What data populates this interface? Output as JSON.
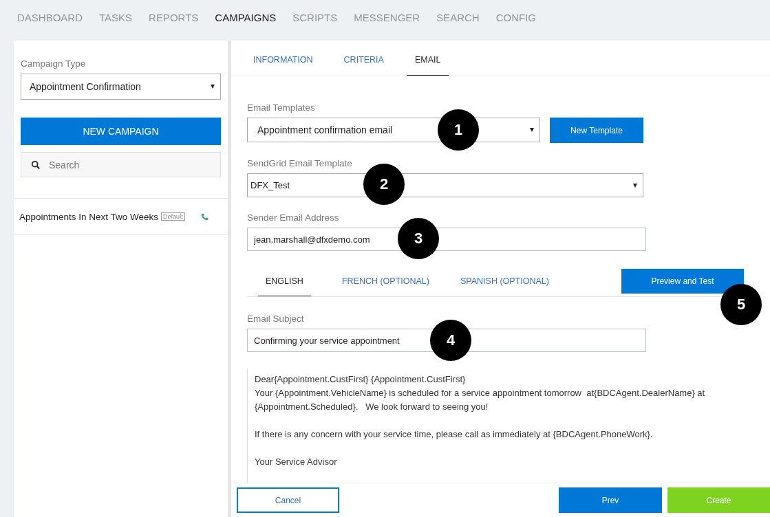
{
  "nav": [
    {
      "label": "DASHBOARD",
      "selected": false
    },
    {
      "label": "TASKS",
      "selected": false
    },
    {
      "label": "REPORTS",
      "selected": false
    },
    {
      "label": "CAMPAIGNS",
      "selected": true
    },
    {
      "label": "SCRIPTS",
      "selected": false
    },
    {
      "label": "MESSENGER",
      "selected": false
    },
    {
      "label": "SEARCH",
      "selected": false
    },
    {
      "label": "CONFIG",
      "selected": false
    }
  ],
  "sidebar": {
    "campaign_type_label": "Campaign Type",
    "campaign_type": "Appointment Confirmation",
    "new_button": "NEW CAMPAIGN",
    "search": {
      "placeholder": "Search"
    },
    "campaigns": [
      {
        "name": "Appointments In Next Two Weeks",
        "badge": "Default"
      }
    ]
  },
  "tabs": [
    {
      "label": "INFORMATION",
      "selected": false
    },
    {
      "label": "CRITERIA",
      "selected": false
    },
    {
      "label": "EMAIL",
      "selected": true
    }
  ],
  "email_templates": {
    "label": "Email Templates",
    "value": "Appointment confirmation email",
    "button": "New Template"
  },
  "sendgrid_template": {
    "label": "SendGrid Email Template",
    "value": "DFX_Test"
  },
  "sender": {
    "label": "Sender Email Address",
    "value": "jean.marshall@dfxdemo.com"
  },
  "language_tabs": [
    {
      "label": "ENGLISH",
      "selected": true
    },
    {
      "label": "FRENCH (OPTIONAL)",
      "selected": false
    },
    {
      "label": "SPANISH (OPTIONAL)",
      "selected": false
    }
  ],
  "preview_button": "Preview and Test",
  "subject": {
    "label": "Email Subject",
    "value": "Confirming your service appointment"
  },
  "body": [
    [
      "Dear{Appointment.CustFirst} {Appointment.CustFirst}",
      "Your {Appointment.VehicleName} is scheduled for a service appointment tomorrow  at{BDCAgent.DealerName} at {Appointment.Scheduled}.   We look forward to seeing you!"
    ],
    [
      "If there is any concern with your service time, please call as immediately at {BDCAgent.PhoneWork}."
    ],
    [
      "Your Service Advisor"
    ]
  ],
  "footer": {
    "cancel": "Cancel",
    "prev": "Prev",
    "create": "Create"
  },
  "callouts": [
    {
      "label": "1"
    },
    {
      "label": "2"
    },
    {
      "label": "3"
    },
    {
      "label": "4"
    },
    {
      "label": "5"
    }
  ]
}
